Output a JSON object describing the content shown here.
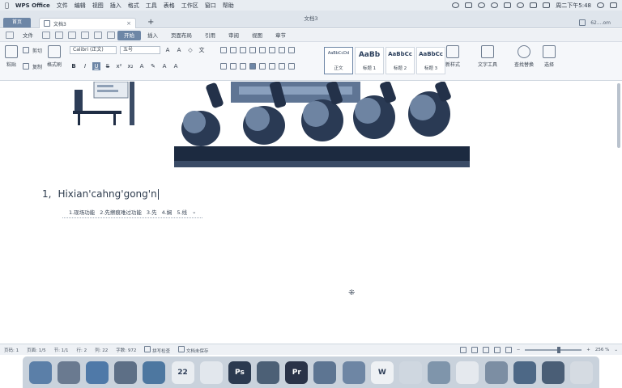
{
  "menubar": {
    "app_name": "WPS Office",
    "items": [
      "文件",
      "编辑",
      "视图",
      "插入",
      "格式",
      "工具",
      "表格",
      "工作区",
      "窗口",
      "帮助"
    ],
    "clock": "周二下午5:48"
  },
  "window": {
    "title": "文档3",
    "home_tab": "首页",
    "doc_tab": "文档3",
    "right_label": "62....om"
  },
  "ribbon_tabs": {
    "file": "文件",
    "items": [
      "开始",
      "插入",
      "页面布局",
      "引用",
      "审阅",
      "视图",
      "章节"
    ],
    "active_index": 0
  },
  "ribbon": {
    "paste": "粘贴",
    "cut": "剪切",
    "copy": "复制",
    "format_painter": "格式刷",
    "font_name": "Calibri (正文)",
    "font_size": "五号",
    "styles": [
      {
        "sample": "AaBbCcDd",
        "name": "正文"
      },
      {
        "sample": "AaBb",
        "name": "标题 1"
      },
      {
        "sample": "AaBbCc",
        "name": "标题 2"
      },
      {
        "sample": "AaBbCc",
        "name": "标题 3"
      }
    ],
    "new_style": "新样式",
    "text_tools": "文字工具",
    "find_replace": "查找替换",
    "select": "选择"
  },
  "document": {
    "list_number": "1,",
    "typed_text": "Hixian'cahng'gong'n",
    "ime_candidates": [
      "1.现场功能",
      "2.先擦痕难过功能",
      "3.先",
      "4.娴",
      "5.线"
    ]
  },
  "statusbar": {
    "page": "页码: 1",
    "pages": "页面: 1/5",
    "section": "节: 1/1",
    "row": "行: 2",
    "col": "列: 22",
    "words": "字数: 972",
    "spell": "拼写检查",
    "backup": "文档未保存",
    "zoom": "256 %",
    "zoom_fraction": 0.6
  },
  "dock": {
    "items": [
      {
        "name": "finder",
        "color": "#5b7fa8"
      },
      {
        "name": "launchpad",
        "color": "#6a7a90"
      },
      {
        "name": "app-store",
        "color": "#4f79a8"
      },
      {
        "name": "xcode",
        "color": "#5d6f86"
      },
      {
        "name": "safari",
        "color": "#4d77a0"
      },
      {
        "name": "calendar",
        "color": "#e9edf1",
        "label": "22"
      },
      {
        "name": "wps-g",
        "color": "#e2e7ed"
      },
      {
        "name": "photoshop",
        "color": "#2b3a50",
        "label": "Ps"
      },
      {
        "name": "bug-app",
        "color": "#4c6076"
      },
      {
        "name": "premiere",
        "color": "#2a3348",
        "label": "Pr"
      },
      {
        "name": "keynote",
        "color": "#5d7592"
      },
      {
        "name": "swirl-app",
        "color": "#6e86a4"
      },
      {
        "name": "wps-writer",
        "color": "#eef1f4",
        "label": "W"
      },
      {
        "name": "qq",
        "color": "#cfd7e0"
      },
      {
        "name": "wechat",
        "color": "#7f95ab"
      },
      {
        "name": "preview",
        "color": "#e5e9ee"
      },
      {
        "name": "screen-app",
        "color": "#7c8ea3"
      },
      {
        "name": "people-app",
        "color": "#4d6886"
      },
      {
        "name": "quicktime",
        "color": "#4a5e76"
      },
      {
        "name": "trash",
        "color": "#d5dbe2"
      }
    ]
  }
}
